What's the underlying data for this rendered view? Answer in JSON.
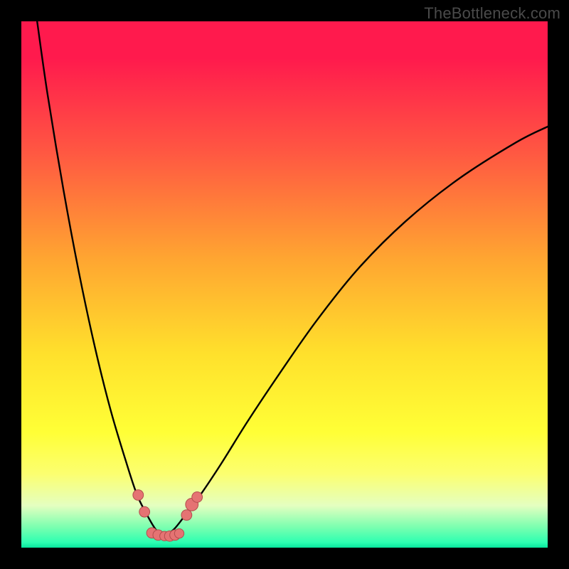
{
  "watermark": "TheBottleneck.com",
  "colors": {
    "background": "#000000",
    "curve_stroke": "#000000",
    "marker_fill": "#e57373",
    "marker_stroke": "#b34d4d",
    "gradient_top": "#ff1a4d",
    "gradient_bottom": "#08e59d"
  },
  "chart_data": {
    "type": "line",
    "title": "",
    "xlabel": "",
    "ylabel": "",
    "xlim": [
      0,
      100
    ],
    "ylim": [
      0,
      100
    ],
    "grid": false,
    "note": "No axes or tick marks are rendered; curve approximates a V-shaped bottleneck graph with minimum near x≈27",
    "series": [
      {
        "name": "left-branch",
        "x": [
          3,
          5,
          8,
          11,
          14,
          17,
          20,
          22,
          24,
          25.5,
          27
        ],
        "y": [
          100,
          86,
          68,
          52,
          38,
          26,
          16,
          10,
          6,
          3.5,
          2
        ]
      },
      {
        "name": "right-branch",
        "x": [
          27,
          29,
          31,
          34,
          38,
          43,
          49,
          56,
          64,
          73,
          83,
          94,
          100
        ],
        "y": [
          2,
          3.5,
          6,
          10,
          16,
          24,
          33,
          43,
          53,
          62,
          70,
          77,
          80
        ]
      }
    ],
    "markers": [
      {
        "x": 22.2,
        "y": 10.0,
        "r": 1.0
      },
      {
        "x": 23.4,
        "y": 6.8,
        "r": 1.0
      },
      {
        "x": 24.8,
        "y": 2.8,
        "r": 1.0
      },
      {
        "x": 26.0,
        "y": 2.4,
        "r": 1.0
      },
      {
        "x": 27.2,
        "y": 2.2,
        "r": 0.9
      },
      {
        "x": 28.2,
        "y": 2.2,
        "r": 1.0
      },
      {
        "x": 29.2,
        "y": 2.4,
        "r": 1.0
      },
      {
        "x": 30.0,
        "y": 2.7,
        "r": 0.9
      },
      {
        "x": 31.4,
        "y": 6.2,
        "r": 1.0
      },
      {
        "x": 32.4,
        "y": 8.2,
        "r": 1.2
      },
      {
        "x": 33.4,
        "y": 9.6,
        "r": 1.0
      }
    ]
  }
}
